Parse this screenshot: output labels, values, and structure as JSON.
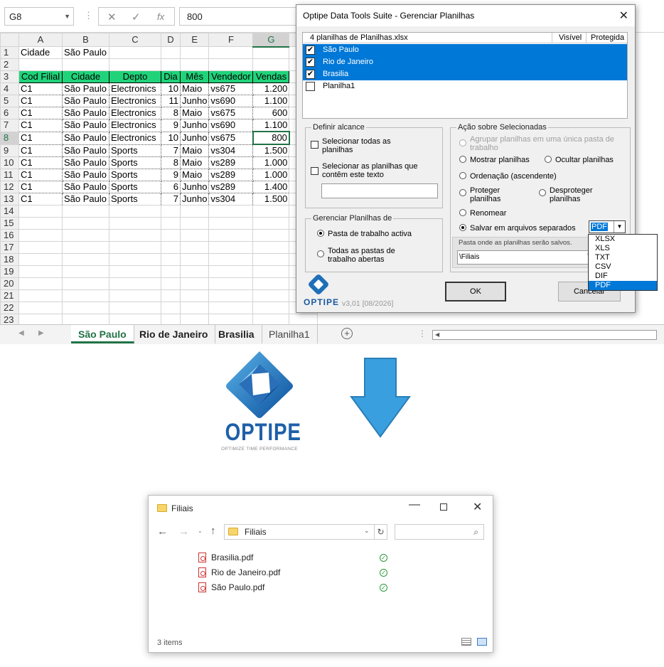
{
  "excel": {
    "name_box": "G8",
    "formula_value": "800",
    "columns": [
      "A",
      "B",
      "C",
      "D",
      "E",
      "F",
      "G"
    ],
    "rows": [
      [
        "1",
        "Cidade",
        "São Paulo",
        "",
        "",
        "",
        "",
        ""
      ],
      [
        "2",
        "",
        "",
        "",
        "",
        "",
        "",
        ""
      ],
      [
        "3",
        "Cod Filial",
        "Cidade",
        "Depto",
        "Dia",
        "Mês",
        "Vendedor",
        "Vendas"
      ],
      [
        "4",
        "C1",
        "São Paulo",
        "Electronics",
        "10",
        "Maio",
        "vs675",
        "1.200"
      ],
      [
        "5",
        "C1",
        "São Paulo",
        "Electronics",
        "11",
        "Junho",
        "vs690",
        "1.100"
      ],
      [
        "6",
        "C1",
        "São Paulo",
        "Electronics",
        "8",
        "Maio",
        "vs675",
        "600"
      ],
      [
        "7",
        "C1",
        "São Paulo",
        "Electronics",
        "9",
        "Junho",
        "vs690",
        "1.100"
      ],
      [
        "8",
        "C1",
        "São Paulo",
        "Electronics",
        "10",
        "Junho",
        "vs675",
        "800"
      ],
      [
        "9",
        "C1",
        "São Paulo",
        "Sports",
        "7",
        "Maio",
        "vs304",
        "1.500"
      ],
      [
        "10",
        "C1",
        "São Paulo",
        "Sports",
        "8",
        "Maio",
        "vs289",
        "1.000"
      ],
      [
        "11",
        "C1",
        "São Paulo",
        "Sports",
        "9",
        "Maio",
        "vs289",
        "1.000"
      ],
      [
        "12",
        "C1",
        "São Paulo",
        "Sports",
        "6",
        "Junho",
        "vs289",
        "1.400"
      ],
      [
        "13",
        "C1",
        "São Paulo",
        "Sports",
        "7",
        "Junho",
        "vs304",
        "1.500"
      ],
      [
        "14",
        "",
        "",
        "",
        "",
        "",
        "",
        ""
      ],
      [
        "15",
        "",
        "",
        "",
        "",
        "",
        "",
        ""
      ],
      [
        "16",
        "",
        "",
        "",
        "",
        "",
        "",
        ""
      ],
      [
        "17",
        "",
        "",
        "",
        "",
        "",
        "",
        ""
      ],
      [
        "18",
        "",
        "",
        "",
        "",
        "",
        "",
        ""
      ],
      [
        "19",
        "",
        "",
        "",
        "",
        "",
        "",
        ""
      ],
      [
        "20",
        "",
        "",
        "",
        "",
        "",
        "",
        ""
      ],
      [
        "21",
        "",
        "",
        "",
        "",
        "",
        "",
        ""
      ],
      [
        "22",
        "",
        "",
        "",
        "",
        "",
        "",
        ""
      ],
      [
        "23",
        "",
        "",
        "",
        "",
        "",
        "",
        ""
      ]
    ],
    "sheet_tabs": [
      "São Paulo",
      "Rio de Janeiro",
      "Brasilia",
      "Planilha1"
    ],
    "header_color": "#20d37a",
    "accent": "#217346"
  },
  "dialog": {
    "title": "Optipe Data Tools Suite - Gerenciar Planilhas",
    "list_header": "4 planilhas de Planilhas.xlsx",
    "col_visible": "Visível",
    "col_protected": "Protegida",
    "sheets": [
      {
        "name": "São Paulo",
        "checked": true
      },
      {
        "name": "Rio de Janeiro",
        "checked": true
      },
      {
        "name": "Brasilia",
        "checked": true
      },
      {
        "name": "Planilha1",
        "checked": false
      }
    ],
    "scope": {
      "legend": "Definir alcance",
      "select_all": "Selecionar todas as planilhas",
      "select_containing": "Selecionar as planilhas que contêm este texto"
    },
    "manage": {
      "legend": "Gerenciar Planilhas de",
      "active_workbook": "Pasta de trabalho activa",
      "all_open": "Todas as pastas de trabalho abertas"
    },
    "actions": {
      "legend": "Ação sobre Selecionadas",
      "merge": "Agrupar planilhas em uma única pasta de trabalho",
      "show": "Mostrar planilhas",
      "hide": "Ocultar planilhas",
      "sort": "Ordenação (ascendente)",
      "protect": "Proteger planilhas",
      "unprotect": "Desproteger planilhas",
      "rename": "Renomear",
      "save_separate": "Salvar em arquivos separados",
      "format_selected": "PDF",
      "folder_caption": "Pasta onde as planilhas serão salvos.",
      "folder_value": "\\Filiais"
    },
    "format_options": [
      "XLSX",
      "XLS",
      "TXT",
      "CSV",
      "DIF",
      "PDF"
    ],
    "ok": "OK",
    "cancel": "Cancelar",
    "brand": "OPTIPE",
    "version": "v3,01 [08/2026]"
  },
  "logo": {
    "name": "OPTIPE",
    "tagline": "OPTIMIZE TIME PERFORMANCE"
  },
  "explorer": {
    "title": "Filiais",
    "address": "Filiais",
    "files": [
      "Brasilia.pdf",
      "Rio de Janeiro.pdf",
      "São Paulo.pdf"
    ],
    "status": "3 items"
  }
}
